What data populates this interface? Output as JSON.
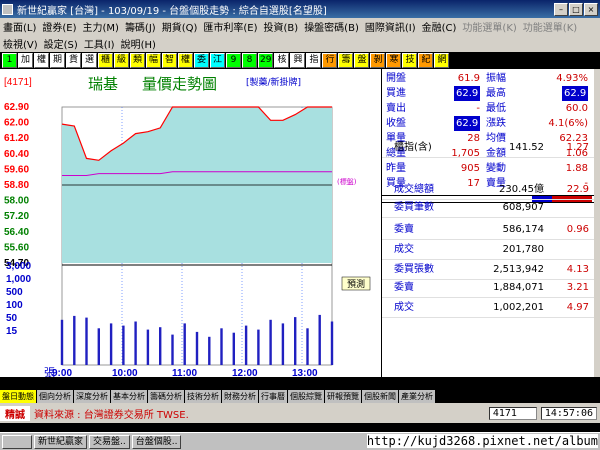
{
  "window": {
    "title": "新世紀贏家 [台灣] - 103/09/19 - 台盤個股走勢 : 綜合自選股[名望股]"
  },
  "menu": {
    "row1": [
      "畫面(L)",
      "證券(E)",
      "主力(M)",
      "籌碼(J)",
      "期貨(Q)",
      "匯市利率(E)",
      "投資(B)",
      "操盤密碼(B)",
      "國際資訊(I)",
      "金融(C)",
      "功能選單(K)",
      "功能選單(K)"
    ],
    "row2": [
      "檢視(V)",
      "設定(S)",
      "工具(I)",
      "說明(H)"
    ]
  },
  "toolbar": {
    "buttons": [
      "1",
      "加",
      "權",
      "期",
      "貨",
      "選",
      "櫃",
      "級",
      "類",
      "幅",
      "智",
      "權",
      "委",
      "江",
      "9",
      "8",
      "29",
      "核",
      "興",
      "指",
      "行",
      "籌",
      "盤",
      "剝",
      "寒",
      "技",
      "紀",
      "網"
    ]
  },
  "chart": {
    "code": "[4171]",
    "name": "瑞基",
    "title": "量價走勢圖",
    "tag": "[製藥/新掛牌]",
    "label_hold": "(標盤)",
    "label_vol": "預測",
    "vol_unit": "張",
    "price_ticks": [
      "62.90",
      "62.00",
      "61.20",
      "60.40",
      "59.60",
      "58.80",
      "58.00",
      "57.20",
      "56.40",
      "55.60",
      "54.70"
    ],
    "vol_ticks": [
      "3,000",
      "1,000",
      "500",
      "100",
      "50",
      "15"
    ],
    "time_ticks": [
      "9:00",
      "10:00",
      "11:00",
      "12:00",
      "13:00"
    ]
  },
  "chart_data": {
    "type": "line",
    "x": [
      "9:00",
      "9:05",
      "9:10",
      "9:15",
      "9:20",
      "9:25",
      "9:30",
      "9:40",
      "9:50",
      "10:00",
      "10:10",
      "10:30",
      "11:00",
      "11:30",
      "12:00",
      "12:30",
      "13:00",
      "13:05",
      "13:10",
      "13:15",
      "13:20",
      "13:25",
      "13:30"
    ],
    "series": [
      {
        "name": "price",
        "values": [
          62.0,
          61.9,
          60.2,
          60.1,
          60.6,
          61.0,
          61.5,
          61.6,
          61.8,
          62.9,
          62.9,
          62.9,
          62.9,
          62.9,
          62.9,
          62.9,
          62.9,
          62.2,
          62.2,
          62.5,
          62.9,
          62.9,
          62.9
        ]
      },
      {
        "name": "average",
        "values": [
          59.3,
          59.3,
          59.3,
          59.4,
          59.4,
          59.4,
          59.4,
          59.4,
          59.4,
          59.5,
          59.5,
          59.5,
          59.5,
          59.5,
          59.5,
          59.5,
          59.5,
          59.5,
          59.5,
          59.5,
          59.5,
          59.5,
          59.5
        ]
      }
    ],
    "ylim": [
      54.7,
      62.9
    ],
    "reference": 58.8,
    "volume": {
      "ylim": [
        0,
        3000
      ],
      "values": [
        40,
        55,
        48,
        20,
        30,
        25,
        35,
        18,
        22,
        12,
        30,
        15,
        10,
        20,
        14,
        25,
        18,
        40,
        30,
        50,
        20,
        60,
        35
      ]
    }
  },
  "quote": {
    "rows": [
      {
        "l1": "開盤",
        "v1": "61.9",
        "l2": "振幅",
        "v2": "4.93%"
      },
      {
        "l1": "買進",
        "v1": "62.9",
        "l2": "最高",
        "v2": "62.9"
      },
      {
        "l1": "賣出",
        "v1": "-",
        "l2": "最低",
        "v2": "60.0"
      },
      {
        "l1": "收盤",
        "v1": "62.9",
        "l2": "漲跌",
        "v2": "4.1(6%)"
      },
      {
        "l1": "單量",
        "v1": "28",
        "l2": "均價",
        "v2": "62.23"
      },
      {
        "l1": "總量",
        "v1": "1,705",
        "l2": "金額",
        "v2": "1.06"
      },
      {
        "l1": "昨量",
        "v1": "905",
        "l2": "變動",
        "v2": "1.88"
      },
      {
        "l1": "買量",
        "v1": "17",
        "l2": "賣量",
        "v2": "-"
      }
    ],
    "big": [
      {
        "l": "櫃指(含)",
        "v": "141.52",
        "v2": "1.27"
      },
      {
        "l": "成交總額",
        "v": "230.45億",
        "v2": "22.9"
      },
      {
        "l": "委買筆數",
        "v": "608,907",
        "v2": ""
      },
      {
        "l": "委賣",
        "v": "586,174",
        "v2": "0.96"
      },
      {
        "l": "成交",
        "v": "201,780",
        "v2": ""
      },
      {
        "l": "委買張數",
        "v": "2,513,942",
        "v2": "4.13"
      },
      {
        "l": "委賣",
        "v": "1,884,071",
        "v2": "3.21"
      },
      {
        "l": "成交",
        "v": "1,002,201",
        "v2": "4.97"
      }
    ]
  },
  "tabs": [
    "盤日動態",
    "個向分析",
    "深度分析",
    "基本分析",
    "籌碼分析",
    "技術分析",
    "財務分析",
    "行事曆",
    "個股綜覽",
    "研報預覽",
    "個股新聞",
    "產業分析"
  ],
  "status": {
    "label": "精誠",
    "source": "資料來源 : 台灣證券交易所 TWSE.",
    "code": "4171",
    "time": "14:57:06"
  },
  "taskbar": {
    "items": [
      "新世紀贏家",
      "交易盤..",
      "台盤個股.."
    ],
    "url": "http://kujd3268.pixnet.net/album"
  },
  "colors": {
    "up": "#ff0000",
    "down": "#008000",
    "fill": "#a8e0e0",
    "avg": "#cc00cc",
    "grid": "#3060ff",
    "vol": "#2020c0"
  }
}
